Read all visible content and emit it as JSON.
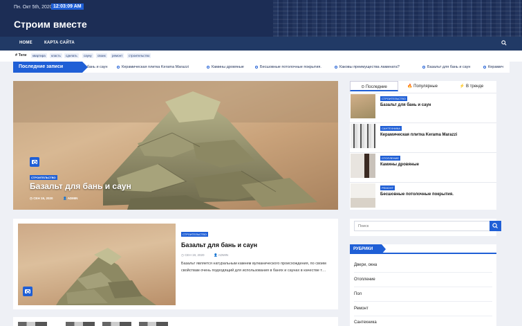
{
  "topbar": {
    "date": "Пн. Окт 5th, 2020",
    "time": "12:03:09 AM"
  },
  "site": {
    "title": "Строим вместе"
  },
  "nav": {
    "items": [
      "HOME",
      "КАРТА САЙТА"
    ]
  },
  "tags": {
    "label": "Теги",
    "items": [
      "квартира",
      "класть",
      "сделать",
      "сауну",
      "своих",
      "ремонт",
      "строительство"
    ]
  },
  "ticker": {
    "label": "Последние записи",
    "items": [
      "для бань и саун",
      "Керамическая плитка Kerama Marazzi",
      "Камины дровяные",
      "Бесшовные потолочные покрытия.",
      "Каковы преимущества ламината?",
      "Базальт для бань и саун",
      "Керамич"
    ]
  },
  "hero": {
    "category": "СТРОИТЕЛЬСТВО",
    "title": "Базальт для бань и саун",
    "date": "СЕН 19, 2020",
    "author": "ADMIN"
  },
  "tabs": {
    "items": [
      "Последние",
      "Популярные",
      "В тренде"
    ],
    "posts": [
      {
        "category": "СТРОИТЕЛЬСТВО",
        "title": "Базальт для бань и саун"
      },
      {
        "category": "САНТЕХНИКА",
        "title": "Керамическая плитка Kerama Marazzi"
      },
      {
        "category": "ОТОПЛЕНИЕ",
        "title": "Камины дровяные"
      },
      {
        "category": "РЕМОНТ",
        "title": "Бесшовные потолочные покрытия."
      }
    ]
  },
  "card": {
    "category": "СТРОИТЕЛЬСТВО",
    "title": "Базальт для бань и саун",
    "date": "СЕН 19, 2020",
    "author": "ADMIN",
    "excerpt": "Базальт является натуральным камнем вулканического происхождения, по своим свойствам очень подходящий для использования в банях и саунах в качестве т…"
  },
  "search": {
    "placeholder": "Поиск"
  },
  "categories": {
    "label": "РУБРИКИ",
    "items": [
      "Двери, окна",
      "Отопление",
      "Пол",
      "Ремонт",
      "Сантехника"
    ]
  },
  "colors": {
    "accent": "#1f5fd6",
    "header": "#1c2d55",
    "nav": "#213a66"
  }
}
